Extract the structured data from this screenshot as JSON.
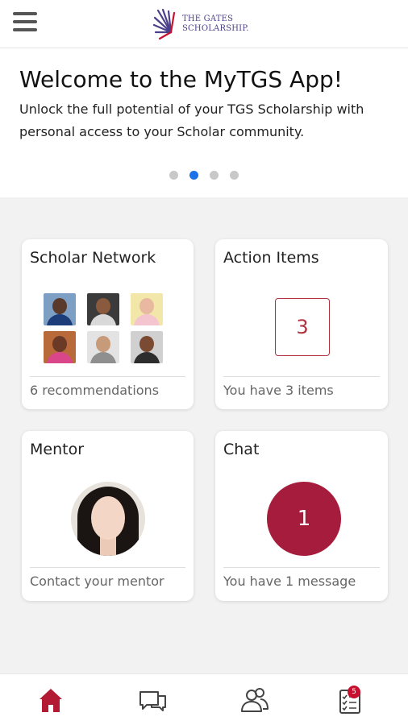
{
  "header": {
    "logo_line1": "THE GATES",
    "logo_line2": "SCHOLARSHIP.",
    "menu_icon": "hamburger-menu-icon"
  },
  "banner": {
    "title": "Welcome to the MyTGS App!",
    "text": "Unlock the full potential of your TGS Scholarship with personal access to your Scholar community.",
    "page_count": 4,
    "active_page": 2
  },
  "cards": {
    "network": {
      "title": "Scholar Network",
      "footer": "6 recommendations"
    },
    "actions": {
      "title": "Action Items",
      "count": "3",
      "footer": "You have 3 items"
    },
    "mentor": {
      "title": "Mentor",
      "footer": "Contact your mentor"
    },
    "chat": {
      "title": "Chat",
      "count": "1",
      "footer": "You have 1 message"
    }
  },
  "bottom_nav": {
    "items": [
      {
        "name": "home",
        "icon": "home-icon",
        "active": true
      },
      {
        "name": "messages",
        "icon": "chat-bubbles-icon",
        "active": false
      },
      {
        "name": "network",
        "icon": "people-icon",
        "active": false
      },
      {
        "name": "tasks",
        "icon": "checklist-icon",
        "active": false,
        "badge": "5"
      }
    ]
  },
  "colors": {
    "brand_purple": "#4b3f8c",
    "accent_red": "#a61c3c",
    "active_dot": "#1a73e8"
  }
}
